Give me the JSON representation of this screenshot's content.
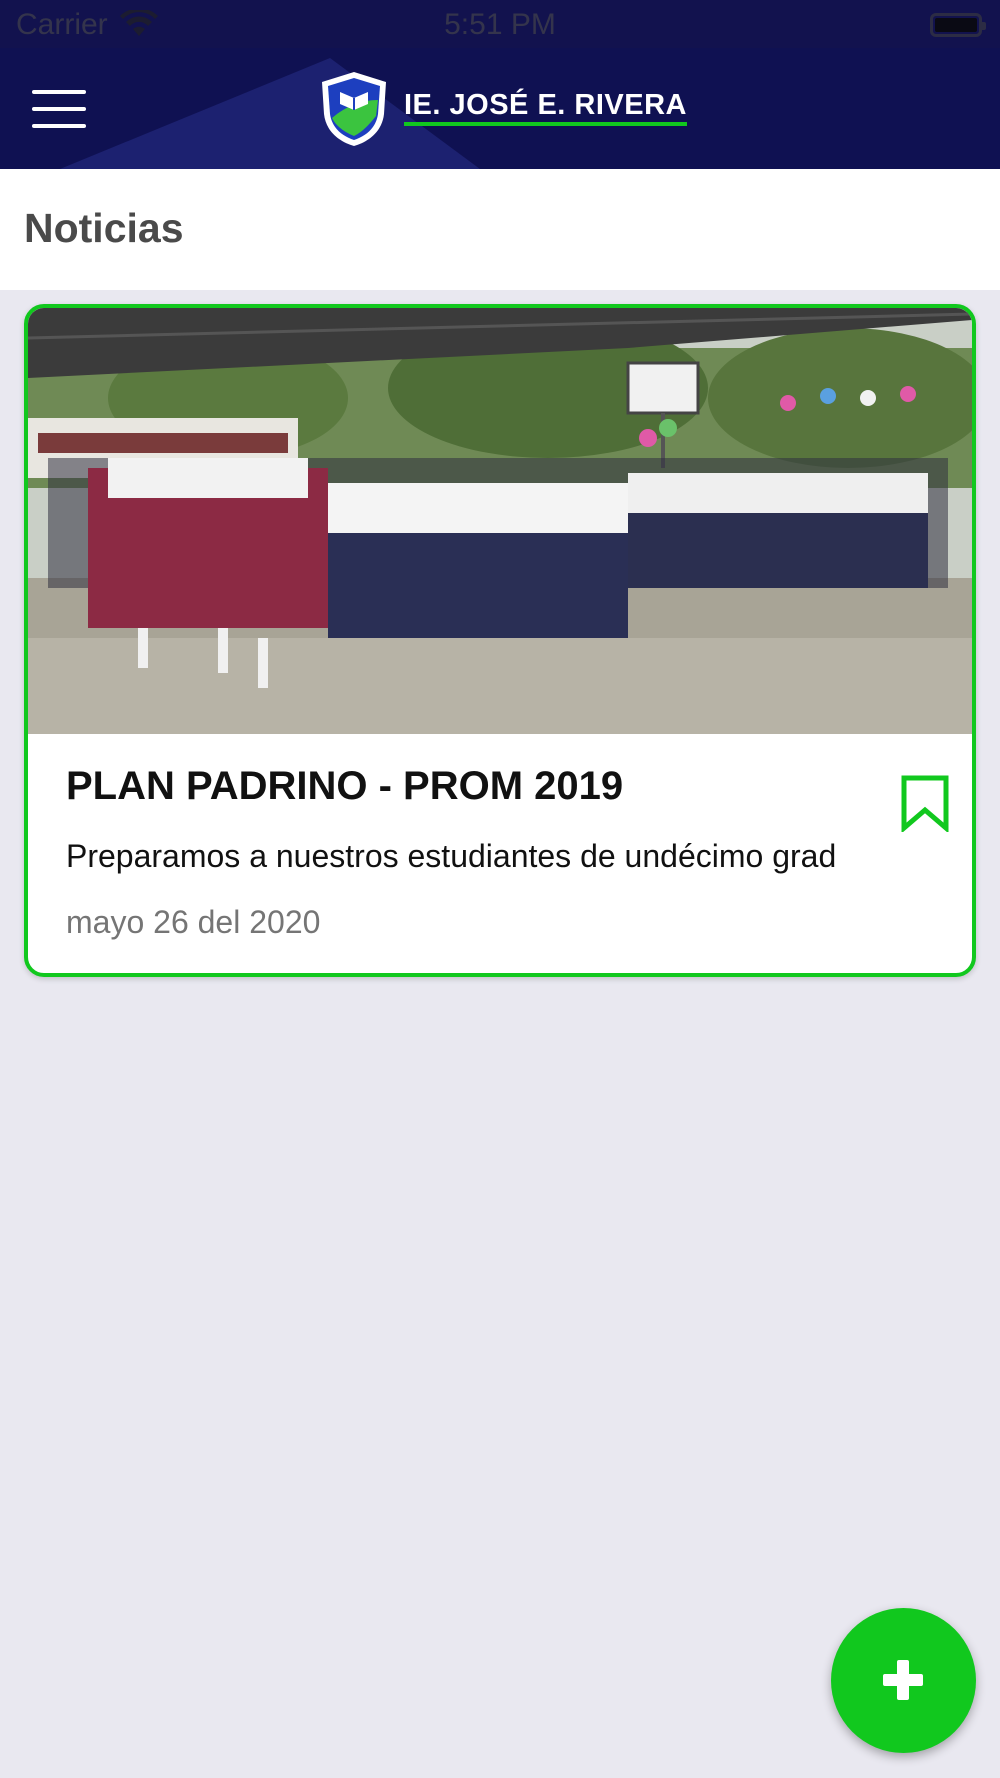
{
  "status_bar": {
    "carrier": "Carrier",
    "time": "5:51 PM",
    "icons": [
      "wifi-icon",
      "battery-icon"
    ]
  },
  "header": {
    "brand": "IE. JOSÉ E. RIVERA",
    "menu_icon": "hamburger-menu-icon",
    "logo_icon": "school-shield-logo",
    "colors": {
      "header_bg": "#0f1152",
      "accent": "#11c81e"
    }
  },
  "page": {
    "title": "Noticias"
  },
  "news": [
    {
      "title": "PLAN PADRINO - PROM 2019",
      "summary": "Preparamos a nuestros estudiantes de undécimo grad",
      "date": "mayo 26 del 2020",
      "image": "photo of students in school uniforms seated and standing under a covered court",
      "bookmark_icon": "bookmark-icon"
    }
  ],
  "fab": {
    "icon": "plus-icon"
  }
}
